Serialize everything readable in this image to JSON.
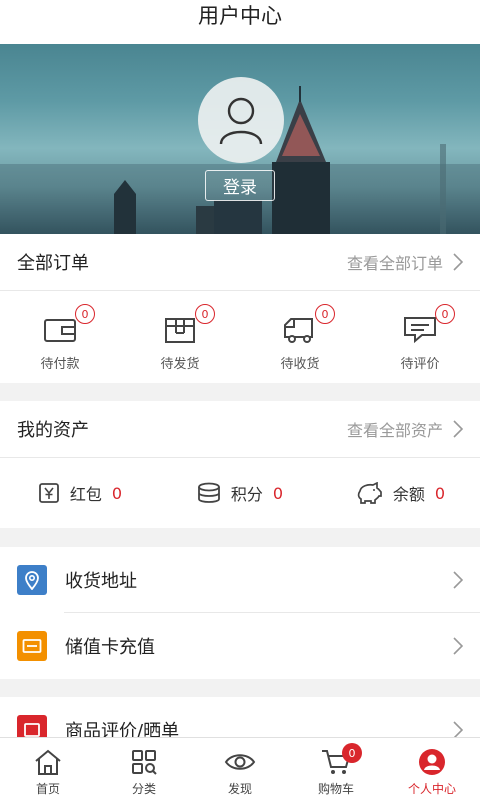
{
  "header": {
    "title": "用户中心"
  },
  "profile": {
    "login_label": "登录"
  },
  "orders": {
    "label": "全部订单",
    "more": "查看全部订单",
    "items": [
      {
        "label": "待付款",
        "count": "0",
        "icon": "wallet-icon"
      },
      {
        "label": "待发货",
        "count": "0",
        "icon": "package-icon"
      },
      {
        "label": "待收货",
        "count": "0",
        "icon": "truck-icon"
      },
      {
        "label": "待评价",
        "count": "0",
        "icon": "comment-icon"
      }
    ]
  },
  "assets": {
    "label": "我的资产",
    "more": "查看全部资产",
    "items": [
      {
        "label": "红包",
        "value": "0",
        "icon": "red-packet-icon"
      },
      {
        "label": "积分",
        "value": "0",
        "icon": "coins-icon"
      },
      {
        "label": "余额",
        "value": "0",
        "icon": "piggy-bank-icon"
      }
    ]
  },
  "menu": [
    {
      "label": "收货地址",
      "icon": "location-icon",
      "color": "#3d7fc8"
    },
    {
      "label": "储值卡充值",
      "icon": "card-icon",
      "color": "#f39000"
    },
    {
      "label": "商品评价/晒单",
      "icon": "review-icon",
      "color": "#d9262c"
    }
  ],
  "tabbar": {
    "items": [
      {
        "label": "首页",
        "icon": "home-icon"
      },
      {
        "label": "分类",
        "icon": "category-icon"
      },
      {
        "label": "发现",
        "icon": "eye-icon"
      },
      {
        "label": "购物车",
        "icon": "cart-icon",
        "badge": "0"
      },
      {
        "label": "个人中心",
        "icon": "user-icon",
        "active": true
      }
    ]
  },
  "colors": {
    "accent": "#d9262c",
    "blue": "#3d7fc8",
    "orange": "#f39000"
  }
}
